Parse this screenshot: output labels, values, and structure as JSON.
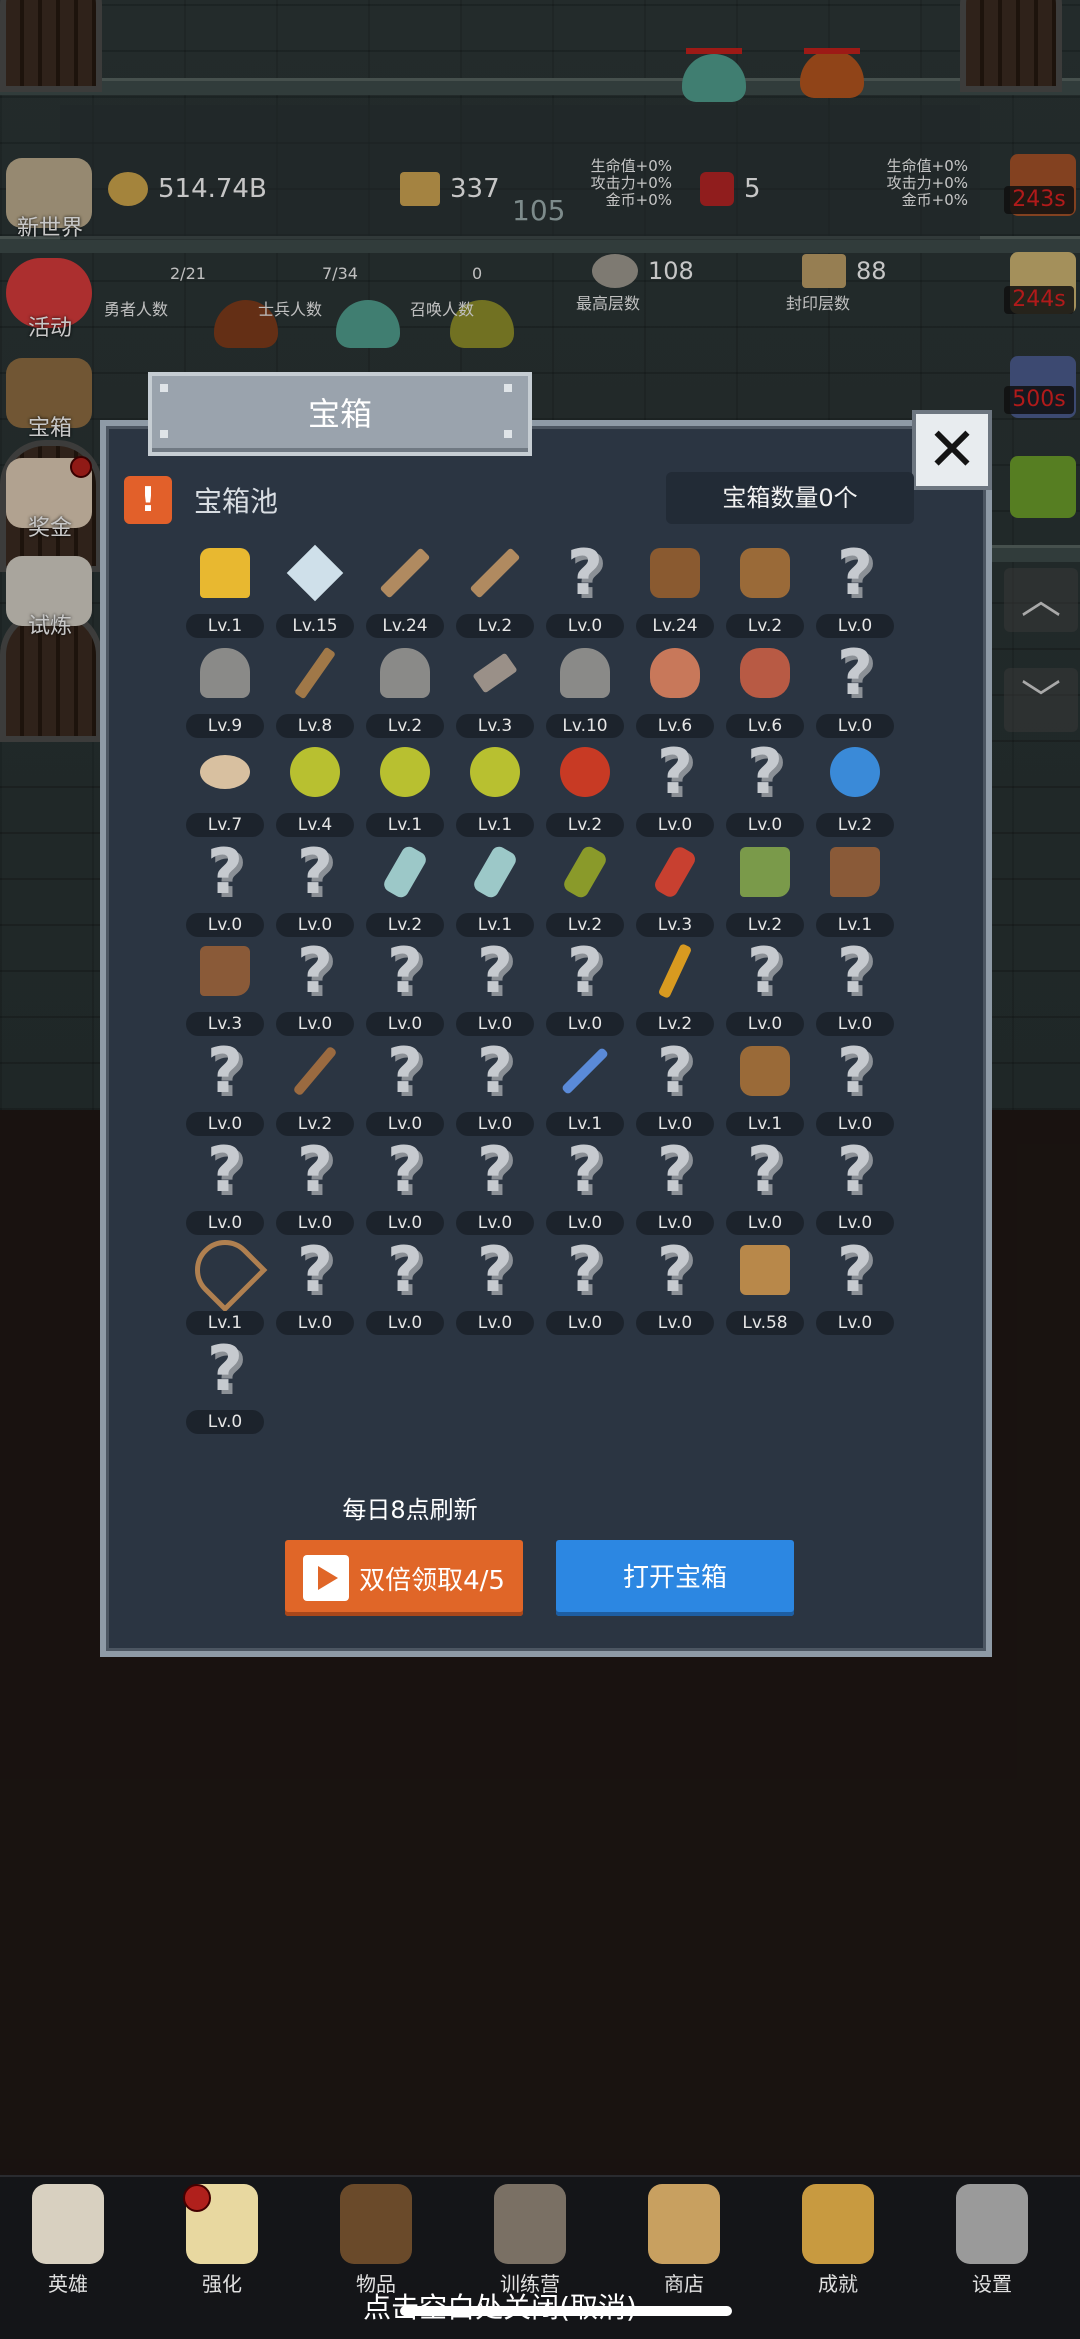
{
  "hud": {
    "gold": "514.74B",
    "scroll": "337",
    "scroll_sub": "105",
    "gem": "5",
    "bonus_left": [
      "生命值+0%",
      "攻击力+0%",
      "金币+0%"
    ],
    "bonus_right": [
      "生命值+0%",
      "攻击力+0%",
      "金币+0%"
    ],
    "stats": [
      {
        "value": "2/21",
        "label": "勇者人数"
      },
      {
        "value": "7/34",
        "label": "士兵人数"
      },
      {
        "value": "0",
        "label": "召唤人数"
      },
      {
        "value": "108",
        "label": "最高层数"
      },
      {
        "value": "88",
        "label": "封印层数"
      }
    ]
  },
  "left_menu": [
    "新世界",
    "活动",
    "宝箱",
    "奖金",
    "试炼"
  ],
  "right_timers": [
    "243s",
    "244s",
    "500s"
  ],
  "modal": {
    "title": "宝箱",
    "pool_title": "宝箱池",
    "chest_count": "宝箱数量0个",
    "refresh_note": "每日8点刷新",
    "double_button": "双倍领取4/5",
    "open_button": "打开宝箱",
    "items": [
      {
        "icon": "crown",
        "lv": "Lv.1"
      },
      {
        "icon": "diamond",
        "lv": "Lv.15"
      },
      {
        "icon": "sword",
        "lv": "Lv.24"
      },
      {
        "icon": "sword",
        "lv": "Lv.2"
      },
      {
        "icon": "unknown",
        "lv": "Lv.0"
      },
      {
        "icon": "armor",
        "lv": "Lv.24"
      },
      {
        "icon": "backpack",
        "lv": "Lv.2"
      },
      {
        "icon": "unknown",
        "lv": "Lv.0"
      },
      {
        "icon": "helmet",
        "lv": "Lv.9"
      },
      {
        "icon": "dagger",
        "lv": "Lv.8"
      },
      {
        "icon": "helmet",
        "lv": "Lv.2"
      },
      {
        "icon": "hammer",
        "lv": "Lv.3"
      },
      {
        "icon": "helmet",
        "lv": "Lv.10"
      },
      {
        "icon": "meat",
        "lv": "Lv.6"
      },
      {
        "icon": "steak",
        "lv": "Lv.6"
      },
      {
        "icon": "unknown",
        "lv": "Lv.0"
      },
      {
        "icon": "bread",
        "lv": "Lv.7"
      },
      {
        "icon": "potion-yellow",
        "lv": "Lv.4"
      },
      {
        "icon": "potion-yellow",
        "lv": "Lv.1"
      },
      {
        "icon": "potion-yellow",
        "lv": "Lv.1"
      },
      {
        "icon": "potion-red",
        "lv": "Lv.2"
      },
      {
        "icon": "unknown",
        "lv": "Lv.0"
      },
      {
        "icon": "unknown",
        "lv": "Lv.0"
      },
      {
        "icon": "potion-blue",
        "lv": "Lv.2"
      },
      {
        "icon": "unknown",
        "lv": "Lv.0"
      },
      {
        "icon": "unknown",
        "lv": "Lv.0"
      },
      {
        "icon": "vial",
        "lv": "Lv.2"
      },
      {
        "icon": "vial",
        "lv": "Lv.1"
      },
      {
        "icon": "bottle-green",
        "lv": "Lv.2"
      },
      {
        "icon": "bottle-red",
        "lv": "Lv.3"
      },
      {
        "icon": "boot-winged",
        "lv": "Lv.2"
      },
      {
        "icon": "boot",
        "lv": "Lv.1"
      },
      {
        "icon": "boot",
        "lv": "Lv.3"
      },
      {
        "icon": "unknown",
        "lv": "Lv.0"
      },
      {
        "icon": "unknown",
        "lv": "Lv.0"
      },
      {
        "icon": "unknown",
        "lv": "Lv.0"
      },
      {
        "icon": "unknown",
        "lv": "Lv.0"
      },
      {
        "icon": "torch",
        "lv": "Lv.2"
      },
      {
        "icon": "unknown",
        "lv": "Lv.0"
      },
      {
        "icon": "unknown",
        "lv": "Lv.0"
      },
      {
        "icon": "unknown",
        "lv": "Lv.0"
      },
      {
        "icon": "staff",
        "lv": "Lv.2"
      },
      {
        "icon": "unknown",
        "lv": "Lv.0"
      },
      {
        "icon": "unknown",
        "lv": "Lv.0"
      },
      {
        "icon": "wand",
        "lv": "Lv.1"
      },
      {
        "icon": "unknown",
        "lv": "Lv.0"
      },
      {
        "icon": "backpack",
        "lv": "Lv.1"
      },
      {
        "icon": "unknown",
        "lv": "Lv.0"
      },
      {
        "icon": "unknown",
        "lv": "Lv.0"
      },
      {
        "icon": "unknown",
        "lv": "Lv.0"
      },
      {
        "icon": "unknown",
        "lv": "Lv.0"
      },
      {
        "icon": "unknown",
        "lv": "Lv.0"
      },
      {
        "icon": "unknown",
        "lv": "Lv.0"
      },
      {
        "icon": "unknown",
        "lv": "Lv.0"
      },
      {
        "icon": "unknown",
        "lv": "Lv.0"
      },
      {
        "icon": "unknown",
        "lv": "Lv.0"
      },
      {
        "icon": "bow",
        "lv": "Lv.1"
      },
      {
        "icon": "unknown",
        "lv": "Lv.0"
      },
      {
        "icon": "unknown",
        "lv": "Lv.0"
      },
      {
        "icon": "unknown",
        "lv": "Lv.0"
      },
      {
        "icon": "unknown",
        "lv": "Lv.0"
      },
      {
        "icon": "unknown",
        "lv": "Lv.0"
      },
      {
        "icon": "beer-mug",
        "lv": "Lv.58"
      },
      {
        "icon": "unknown",
        "lv": "Lv.0"
      },
      {
        "icon": "unknown",
        "lv": "Lv.0"
      }
    ]
  },
  "nav": [
    {
      "label": "英雄",
      "icon": "skull-icon"
    },
    {
      "label": "强化",
      "icon": "candle-icon"
    },
    {
      "label": "物品",
      "icon": "book-icon"
    },
    {
      "label": "训练营",
      "icon": "lantern-icon"
    },
    {
      "label": "商店",
      "icon": "beer-icon"
    },
    {
      "label": "成就",
      "icon": "key-icon"
    },
    {
      "label": "设置",
      "icon": "gear-icon"
    }
  ],
  "close_hint": "点击空白处关闭(取消)",
  "colors": {
    "accent_orange": "#e06628",
    "accent_blue": "#2c87e2",
    "panel": "#2b3542"
  }
}
